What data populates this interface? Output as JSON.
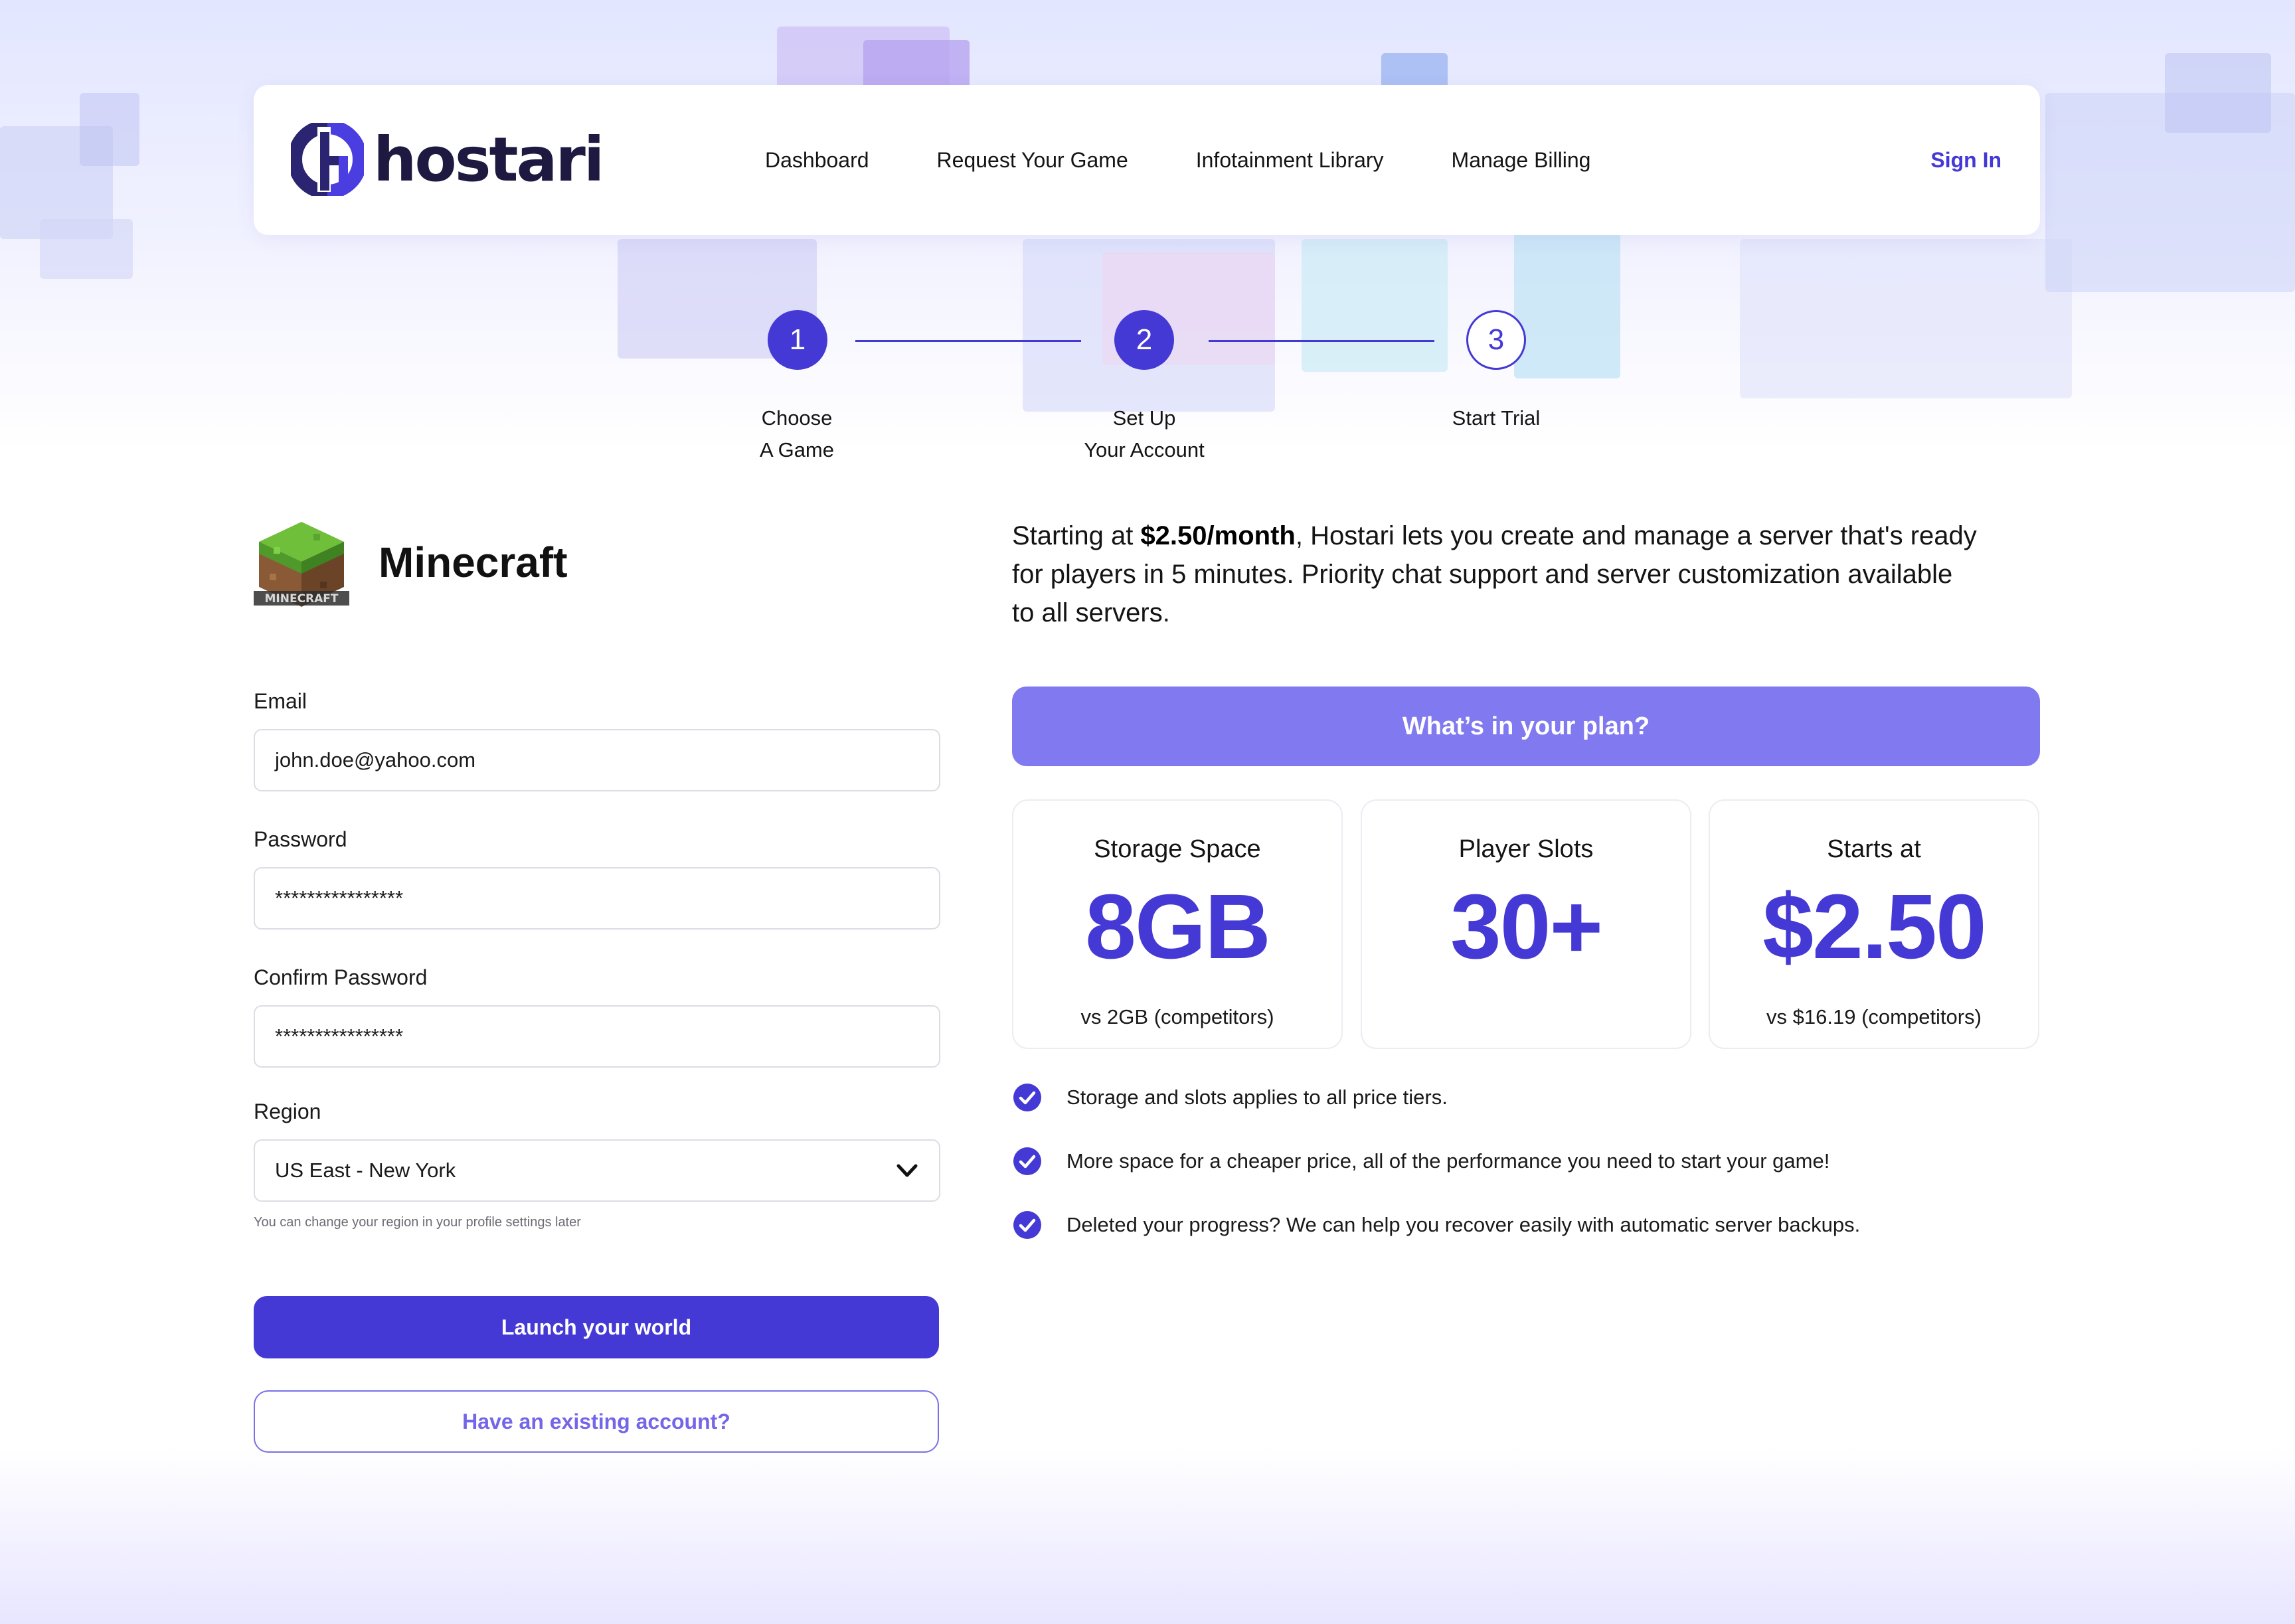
{
  "header": {
    "logo_text": "hostari",
    "nav": [
      "Dashboard",
      "Request Your Game",
      "Infotainment Library",
      "Manage Billing"
    ],
    "sign_in": "Sign In"
  },
  "stepper": {
    "steps": [
      {
        "number": "1",
        "line1": "Choose",
        "line2": "A Game",
        "state": "done"
      },
      {
        "number": "2",
        "line1": "Set Up",
        "line2": "Your Account",
        "state": "current"
      },
      {
        "number": "3",
        "line1": "Start Trial",
        "line2": "",
        "state": "upcoming"
      }
    ]
  },
  "game": {
    "title": "Minecraft",
    "icon": "minecraft-grass-block-icon",
    "icon_caption": "MINECRAFT"
  },
  "form": {
    "email_label": "Email",
    "email_value": "john.doe@yahoo.com",
    "password_label": "Password",
    "password_value": "****************",
    "confirm_label": "Confirm Password",
    "confirm_value": "****************",
    "region_label": "Region",
    "region_value": "US East - New York",
    "region_hint": "You can change your region in your profile settings later",
    "launch_button": "Launch your world",
    "existing_button": "Have an existing account?"
  },
  "intro": {
    "prefix": "Starting at ",
    "price": "$2.50/month",
    "rest": ", Hostari lets you create and manage a server that's ready for players in 5 minutes. Priority chat support and server customization available to all servers."
  },
  "plan": {
    "heading": "What’s in your plan?",
    "cards": [
      {
        "title": "Storage Space",
        "value": "8GB",
        "sub": "vs 2GB (competitors)"
      },
      {
        "title": "Player Slots",
        "value": "30+",
        "sub": ""
      },
      {
        "title": "Starts at",
        "value": "$2.50",
        "sub": "vs $16.19 (competitors)"
      }
    ],
    "features": [
      "Storage and slots applies to all price tiers.",
      "More space for a cheaper price, all of the performance you need to start your game!",
      "Deleted your progress? We can help you recover easily with automatic server backups."
    ]
  },
  "colors": {
    "accent": "#4539d6",
    "accent_light": "#8079f0",
    "text": "#141414"
  }
}
